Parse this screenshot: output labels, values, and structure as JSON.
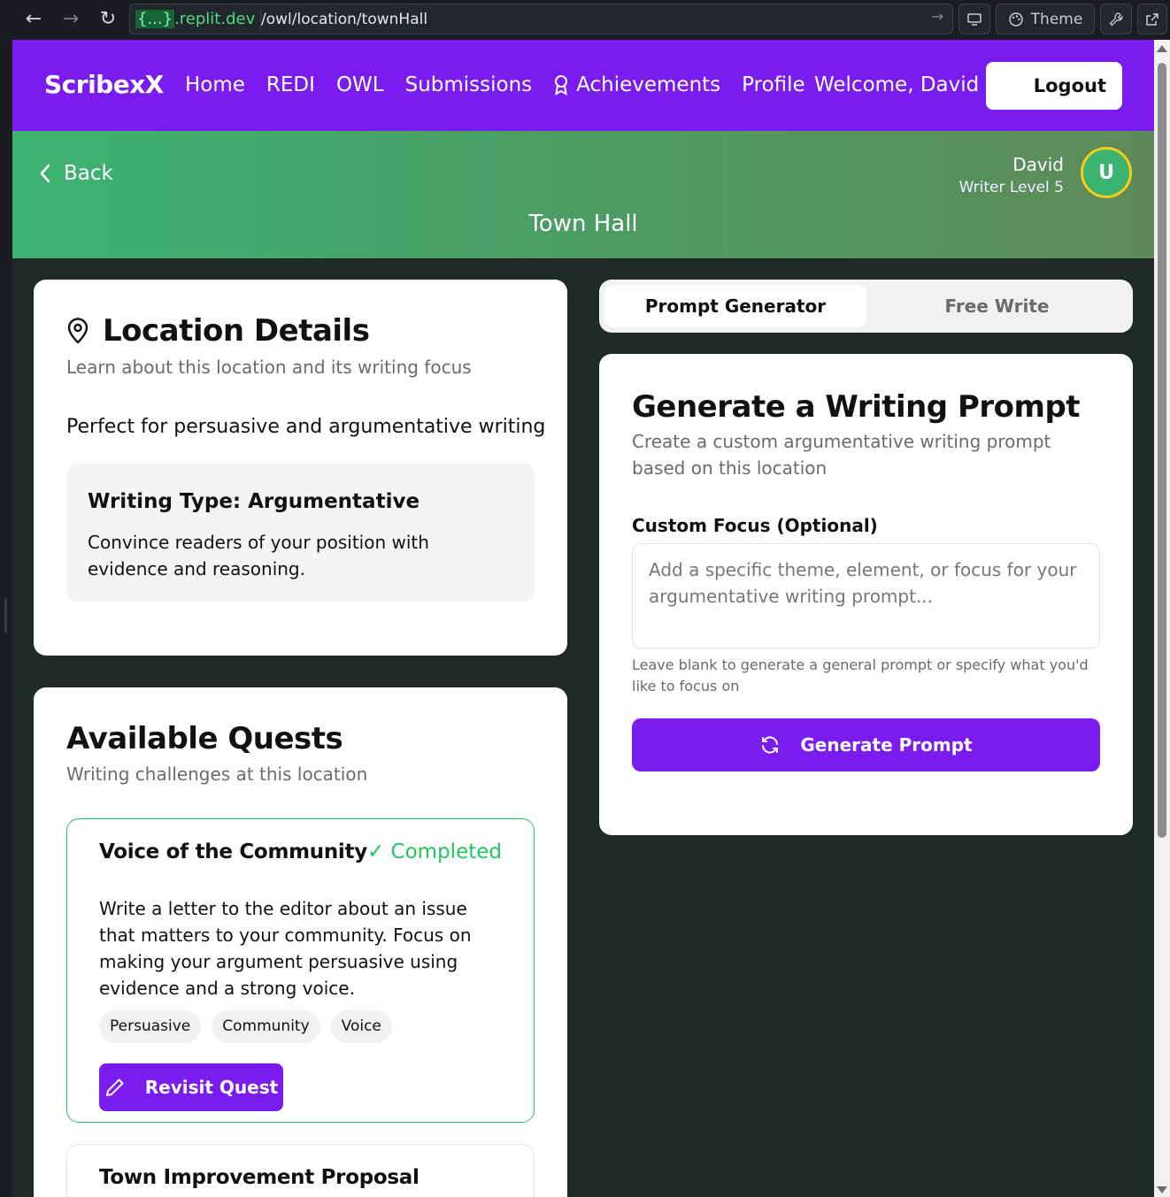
{
  "browser": {
    "url_host_brace": "{...}",
    "url_host": ".replit.dev",
    "url_path": "/owl/location/townHall",
    "theme_label": "Theme"
  },
  "nav": {
    "brand": "ScribexX",
    "links": [
      "Home",
      "REDI",
      "OWL",
      "Submissions",
      "Achievements",
      "Profile"
    ],
    "welcome": "Welcome, David",
    "logout": "Logout"
  },
  "banner": {
    "back": "Back",
    "title": "Town Hall",
    "user_name": "David",
    "user_level": "Writer Level 5",
    "avatar_initial": "U"
  },
  "location": {
    "title": "Location Details",
    "subtitle": "Learn about this location and its writing focus",
    "description": "Perfect for persuasive and argumentative writing",
    "type_title": "Writing Type: Argumentative",
    "type_desc": "Convince readers of your position with evidence and reasoning."
  },
  "quests": {
    "title": "Available Quests",
    "subtitle": "Writing challenges at this location",
    "items": [
      {
        "name": "Voice of the Community",
        "status": "✓ Completed",
        "description": "Write a letter to the editor about an issue that matters to your community. Focus on making your argument persuasive using evidence and a strong voice.",
        "tags": [
          "Persuasive",
          "Community",
          "Voice"
        ],
        "button": "Revisit Quest"
      },
      {
        "name": "Town Improvement Proposal"
      }
    ]
  },
  "tabs": {
    "active": "Prompt Generator",
    "inactive": "Free Write"
  },
  "generator": {
    "title": "Generate a Writing Prompt",
    "subtitle": "Create a custom argumentative writing prompt based on this location",
    "focus_label": "Custom Focus (Optional)",
    "focus_value": "",
    "focus_placeholder": "Add a specific theme, element, or focus for your argumentative writing prompt...",
    "focus_help": "Leave blank to generate a general prompt or specify what you'd like to focus on",
    "button": "Generate Prompt"
  },
  "colors": {
    "brand_purple": "#7a1cf0",
    "banner_green": "#3cb371",
    "completed_green": "#22c55e",
    "page_bg": "#1e2a25"
  }
}
